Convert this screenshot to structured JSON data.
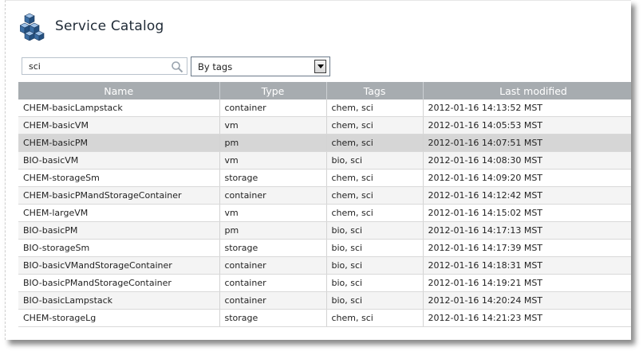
{
  "app": {
    "title": "Service Catalog"
  },
  "search": {
    "value": "sci"
  },
  "filter": {
    "selected": "By tags"
  },
  "table": {
    "columns": [
      "Name",
      "Type",
      "Tags",
      "Last modified"
    ],
    "rows": [
      {
        "name": "CHEM-basicLampstack",
        "type": "container",
        "tags": "chem, sci",
        "modified": "2012-01-16 14:13:52 MST"
      },
      {
        "name": "CHEM-basicVM",
        "type": "vm",
        "tags": "chem, sci",
        "modified": "2012-01-16 14:05:53 MST"
      },
      {
        "name": "CHEM-basicPM",
        "type": "pm",
        "tags": "chem, sci",
        "modified": "2012-01-16 14:07:51 MST"
      },
      {
        "name": "BIO-basicVM",
        "type": "vm",
        "tags": "bio, sci",
        "modified": "2012-01-16 14:08:30 MST"
      },
      {
        "name": "CHEM-storageSm",
        "type": "storage",
        "tags": "chem, sci",
        "modified": "2012-01-16 14:09:20 MST"
      },
      {
        "name": "CHEM-basicPMandStorageContainer",
        "type": "container",
        "tags": "chem, sci",
        "modified": "2012-01-16 14:12:42 MST"
      },
      {
        "name": "CHEM-largeVM",
        "type": "vm",
        "tags": "chem, sci",
        "modified": "2012-01-16 14:15:02 MST"
      },
      {
        "name": "BIO-basicPM",
        "type": "pm",
        "tags": "bio, sci",
        "modified": "2012-01-16 14:17:13 MST"
      },
      {
        "name": "BIO-storageSm",
        "type": "storage",
        "tags": "bio, sci",
        "modified": "2012-01-16 14:17:39 MST"
      },
      {
        "name": "BIO-basicVMandStorageContainer",
        "type": "container",
        "tags": "bio, sci",
        "modified": "2012-01-16 14:18:31 MST"
      },
      {
        "name": "BIO-basicPMandStorageContainer",
        "type": "container",
        "tags": "bio, sci",
        "modified": "2012-01-16 14:19:21 MST"
      },
      {
        "name": "BIO-basicLampstack",
        "type": "container",
        "tags": "bio, sci",
        "modified": "2012-01-16 14:20:24 MST"
      },
      {
        "name": "CHEM-storageLg",
        "type": "storage",
        "tags": "chem, sci",
        "modified": "2012-01-16 14:21:23 MST"
      }
    ],
    "selected_row_index": 2
  },
  "colors": {
    "header_bg": "#a7acb0",
    "selected_row_bg": "#d6d6d6",
    "logo_blue": "#2f5f93"
  },
  "icons": {
    "logo": "boxes-icon",
    "search": "magnifier-icon",
    "dropdown": "chevron-down-icon"
  }
}
